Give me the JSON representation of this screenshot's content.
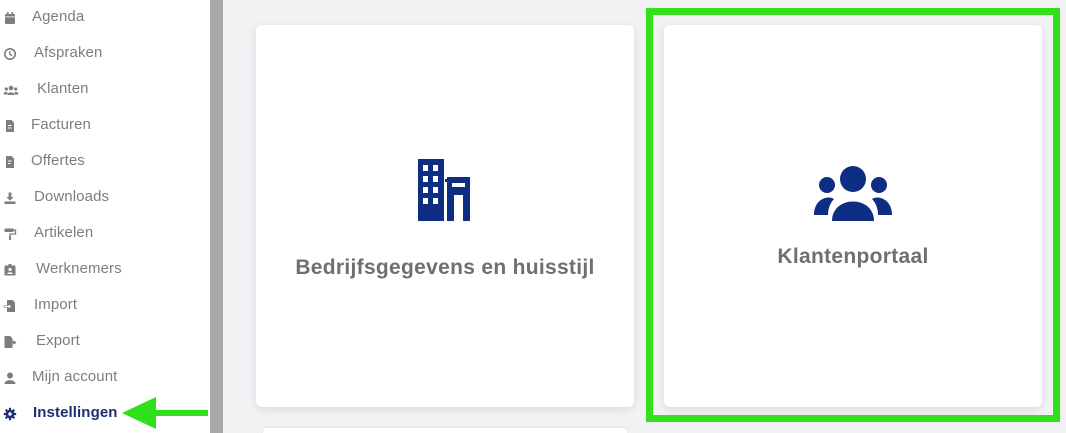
{
  "sidebar": {
    "items": [
      {
        "label": "Agenda",
        "icon": "calendar-icon"
      },
      {
        "label": "Afspraken",
        "icon": "clock-icon"
      },
      {
        "label": "Klanten",
        "icon": "users-icon"
      },
      {
        "label": "Facturen",
        "icon": "invoice-icon"
      },
      {
        "label": "Offertes",
        "icon": "quote-icon"
      },
      {
        "label": "Downloads",
        "icon": "download-icon"
      },
      {
        "label": "Artikelen",
        "icon": "paint-roller-icon"
      },
      {
        "label": "Werknemers",
        "icon": "id-badge-icon"
      },
      {
        "label": "Import",
        "icon": "file-import-icon"
      },
      {
        "label": "Export",
        "icon": "file-export-icon"
      },
      {
        "label": "Mijn account",
        "icon": "user-icon"
      },
      {
        "label": "Instellingen",
        "icon": "gear-icon",
        "active": true
      }
    ]
  },
  "cards": [
    {
      "title": "Bedrijfsgegevens en huisstijl",
      "icon": "building-icon"
    },
    {
      "title": "Klantenportaal",
      "icon": "users-group-icon"
    }
  ],
  "colors": {
    "nav_text": "#7d7d7d",
    "active_text": "#1b2f73",
    "icon_blue": "#0d2e82",
    "card_title": "#6f6f6f",
    "highlight_green": "#2fe01a",
    "background": "#f2f1f4"
  }
}
